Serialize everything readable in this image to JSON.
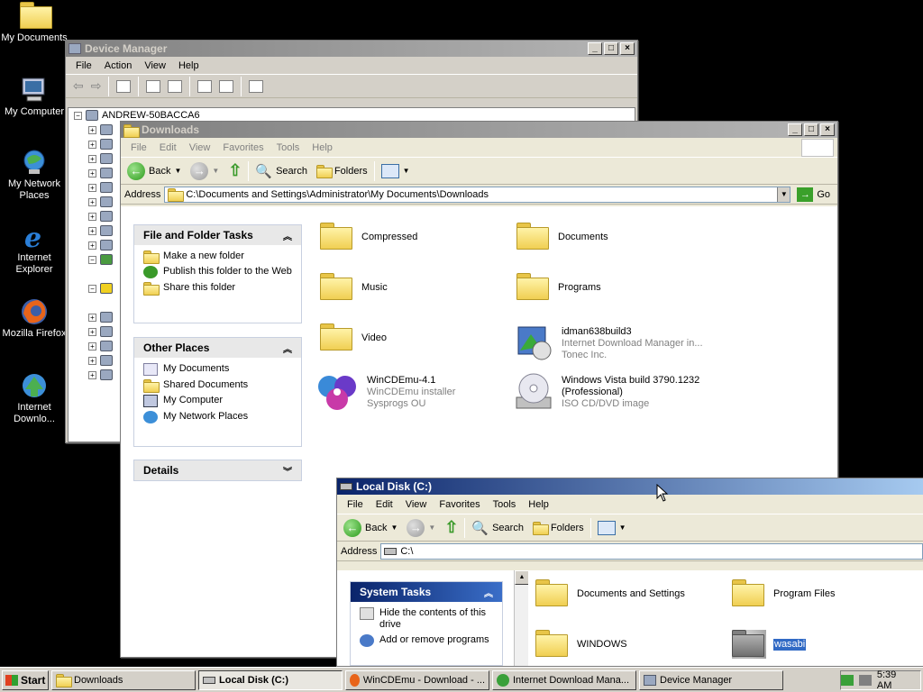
{
  "desktop": {
    "icons": [
      {
        "label": "My Documents",
        "icon": "folder-documents-icon"
      },
      {
        "label": "My Computer",
        "icon": "computer-icon"
      },
      {
        "label": "My Network Places",
        "icon": "network-icon"
      },
      {
        "label": "Internet Explorer",
        "icon": "ie-icon"
      },
      {
        "label": "Mozilla Firefox",
        "icon": "firefox-icon"
      },
      {
        "label": "Internet Downlo...",
        "icon": "idm-icon"
      }
    ]
  },
  "device_manager": {
    "title": "Device Manager",
    "menu": [
      "File",
      "Action",
      "View",
      "Help"
    ],
    "root_node": "ANDREW-50BACCA6"
  },
  "downloads": {
    "title": "Downloads",
    "menu": [
      "File",
      "Edit",
      "View",
      "Favorites",
      "Tools",
      "Help"
    ],
    "toolbar": {
      "back": "Back",
      "search": "Search",
      "folders": "Folders"
    },
    "address_label": "Address",
    "address_value": "C:\\Documents and Settings\\Administrator\\My Documents\\Downloads",
    "go": "Go",
    "file_tasks": {
      "title": "File and Folder Tasks",
      "items": [
        "Make a new folder",
        "Publish this folder to the Web",
        "Share this folder"
      ]
    },
    "other_places": {
      "title": "Other Places",
      "items": [
        "My Documents",
        "Shared Documents",
        "My Computer",
        "My Network Places"
      ]
    },
    "details": {
      "title": "Details"
    },
    "files": [
      {
        "name": "Compressed",
        "line2": "",
        "line3": ""
      },
      {
        "name": "Documents",
        "line2": "",
        "line3": ""
      },
      {
        "name": "Music",
        "line2": "",
        "line3": ""
      },
      {
        "name": "Programs",
        "line2": "",
        "line3": ""
      },
      {
        "name": "Video",
        "line2": "",
        "line3": ""
      },
      {
        "name": "idman638build3",
        "line2": "Internet Download Manager in...",
        "line3": "Tonec Inc."
      },
      {
        "name": "WinCDEmu-4.1",
        "line2": "WinCDEmu installer",
        "line3": "Sysprogs OU"
      },
      {
        "name": "Windows Vista build 3790.1232 (Professional)",
        "line2": "ISO CD/DVD image",
        "line3": ""
      }
    ]
  },
  "local_disk": {
    "title": "Local Disk (C:)",
    "menu": [
      "File",
      "Edit",
      "View",
      "Favorites",
      "Tools",
      "Help"
    ],
    "toolbar": {
      "back": "Back",
      "search": "Search",
      "folders": "Folders"
    },
    "address_label": "Address",
    "address_value": "C:\\",
    "system_tasks": {
      "title": "System Tasks",
      "items": [
        "Hide the contents of this drive",
        "Add or remove programs"
      ]
    },
    "files": [
      {
        "name": "Documents and Settings"
      },
      {
        "name": "Program Files"
      },
      {
        "name": "WINDOWS"
      },
      {
        "name": "wasabi"
      }
    ]
  },
  "taskbar": {
    "start": "Start",
    "tasks": [
      {
        "label": "Downloads"
      },
      {
        "label": "Local Disk (C:)"
      },
      {
        "label": "WinCDEmu - Download - ..."
      },
      {
        "label": "Internet Download Mana..."
      },
      {
        "label": "Device Manager"
      }
    ],
    "clock": "5:39 AM"
  }
}
